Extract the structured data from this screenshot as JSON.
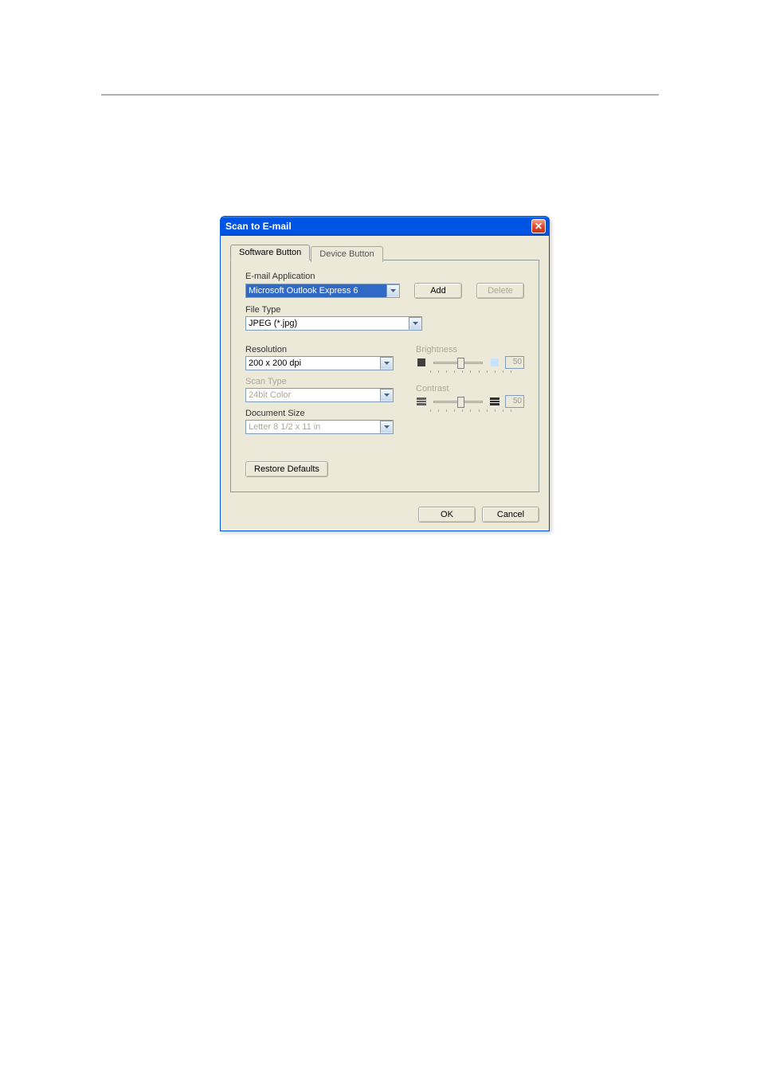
{
  "window": {
    "title": "Scan to E-mail"
  },
  "tabs": {
    "software": "Software Button",
    "device": "Device Button"
  },
  "labels": {
    "email_app": "E-mail Application",
    "file_type": "File Type",
    "resolution": "Resolution",
    "scan_type": "Scan Type",
    "document_size": "Document Size",
    "brightness": "Brightness",
    "contrast": "Contrast"
  },
  "values": {
    "email_app": "Microsoft Outlook Express 6",
    "file_type": "JPEG (*.jpg)",
    "resolution": "200 x 200 dpi",
    "scan_type": "24bit Color",
    "document_size": "Letter 8 1/2 x 11 in",
    "brightness": "50",
    "contrast": "50"
  },
  "buttons": {
    "add": "Add",
    "delete": "Delete",
    "restore": "Restore Defaults",
    "ok": "OK",
    "cancel": "Cancel"
  }
}
